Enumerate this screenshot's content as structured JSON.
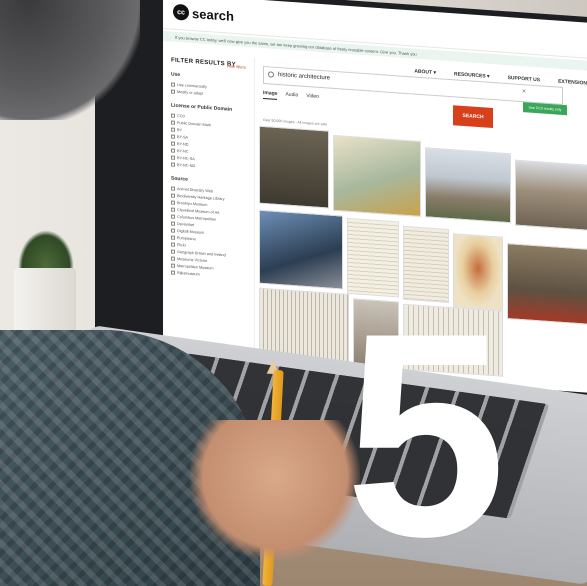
{
  "overlay": {
    "number": "5"
  },
  "app": {
    "logo_letters": "cc",
    "logo_text": "search",
    "banner_text": "If you browse CC today, we'll now give you the same, we are keep growing our database of freely reusable content. Give you. Thank you",
    "nav": [
      "ABOUT ▾",
      "RESOURCES ▾",
      "SUPPORT US",
      "EXTENSION"
    ]
  },
  "sidebar": {
    "title": "FILTER RESULTS BY",
    "hide_label": "Hide filters",
    "sections": [
      {
        "heading": "Use",
        "items": [
          "Use commercially",
          "Modify or adapt"
        ]
      },
      {
        "heading": "License or Public Domain",
        "items": [
          "CC0",
          "Public Domain Mark",
          "BY",
          "BY-SA",
          "BY-ND",
          "BY-NC",
          "BY-NC-SA",
          "BY-NC-ND"
        ]
      },
      {
        "heading": "Source",
        "items": [
          "Animal Diversity Web",
          "Biodiversity Heritage Library",
          "Brooklyn Museum",
          "Cleveland Museum of Art",
          "Columbus Metropolitan",
          "Deviantart",
          "Digitalt Museum",
          "Europeana",
          "Flickr",
          "Geograph Britain and Ireland",
          "Museums Victoria",
          "Metropolitan Museum",
          "Rijksmuseum"
        ]
      }
    ]
  },
  "search": {
    "query": "historic architecture",
    "button_label": "SEARCH",
    "tabs": [
      "Image",
      "Audio",
      "Video"
    ],
    "safe_badge": "Use CC0 results only",
    "results_info": "Over 80,000 images - All images are safe"
  }
}
